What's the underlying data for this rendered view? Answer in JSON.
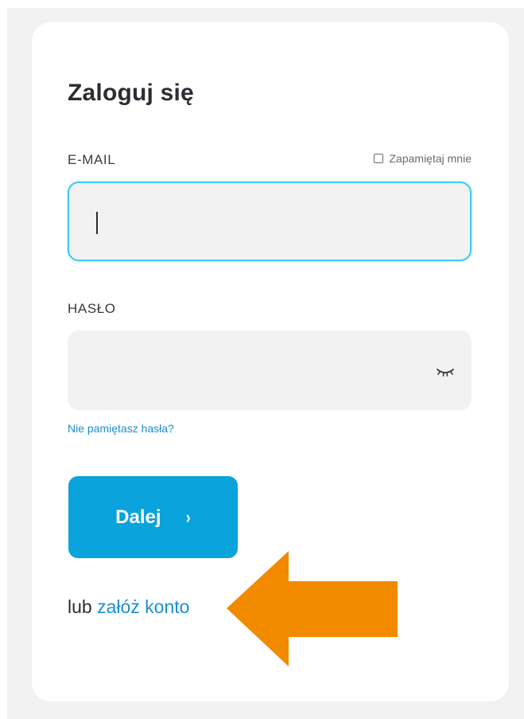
{
  "login": {
    "title": "Zaloguj się",
    "email_label": "E-MAIL",
    "remember_label": "Zapamiętaj mnie",
    "password_label": "HASŁO",
    "forgot_link": "Nie pamiętasz hasła?",
    "next_button": "Dalej",
    "next_chevron": "›",
    "or_text": "lub",
    "register_link": "załóż konto"
  },
  "colors": {
    "accent": "#0aa3dc",
    "focus_border": "#3ecdf0",
    "link": "#1a8fd0",
    "annotation_arrow": "#f28a00"
  },
  "icons": {
    "password_toggle": "eye-closed-icon",
    "annotation": "arrow-left-icon"
  }
}
